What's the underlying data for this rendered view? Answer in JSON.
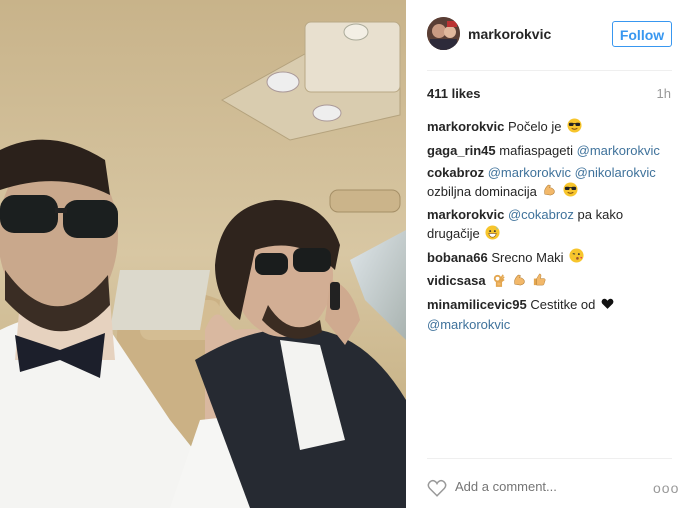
{
  "post": {
    "username": "markorokvic",
    "follow_label": "Follow",
    "likes": "411 likes",
    "time": "1h",
    "add_comment_placeholder": "Add a comment...",
    "more_label": "ooo"
  },
  "comments": [
    {
      "user": "markorokvic",
      "text": "Počelo je",
      "emojis": [
        "sunglasses-emoji"
      ]
    },
    {
      "user": "gaga_rin45",
      "text": "mafiaspageti",
      "mention": "@markorokvic"
    },
    {
      "user": "cokabroz",
      "mention": "@markorokvic",
      "mention2": "@nikolarokvic",
      "text": "ozbiljna dominacija",
      "emojis": [
        "flexed-biceps-emoji",
        "sunglasses-emoji"
      ]
    },
    {
      "user": "markorokvic",
      "mention": "@cokabroz",
      "text": "pa kako drugačije",
      "emojis": [
        "grinning-sweat-emoji"
      ]
    },
    {
      "user": "bobana66",
      "text": "Srecno Maki",
      "emojis": [
        "kiss-emoji"
      ]
    },
    {
      "user": "vidicsasa",
      "emojis": [
        "ok-hand-emoji",
        "flexed-biceps-emoji",
        "thumbs-up-emoji"
      ]
    },
    {
      "user": "minamilicevic95",
      "text": "Cestitke od",
      "mention": "@markorokvic",
      "emojis": [
        "black-heart-emoji"
      ]
    }
  ],
  "colors": {
    "accent": "#3897f0",
    "mention": "#3f729b",
    "muted": "#999999"
  }
}
